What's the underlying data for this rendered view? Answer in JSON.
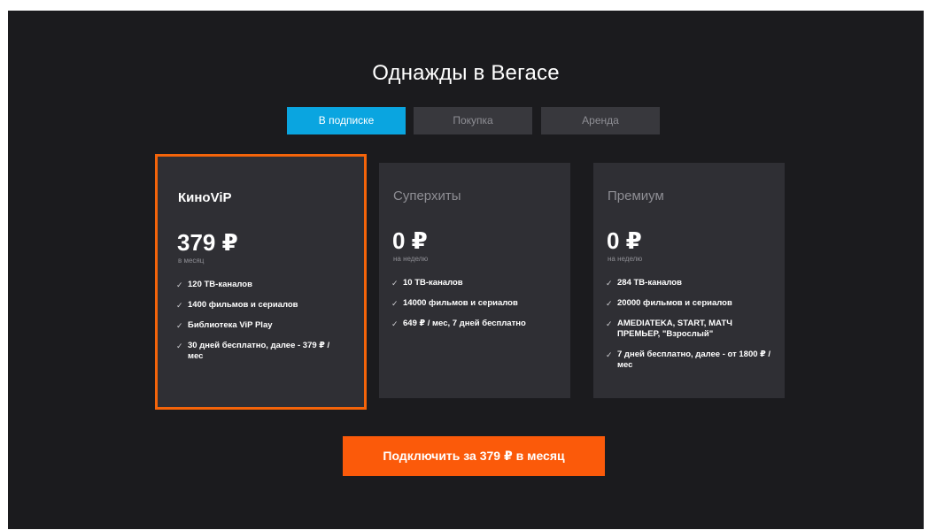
{
  "title": "Однажды в Вегасе",
  "tabs": [
    {
      "label": "В подписке",
      "active": true
    },
    {
      "label": "Покупка",
      "active": false
    },
    {
      "label": "Аренда",
      "active": false
    }
  ],
  "plans": [
    {
      "name": "КиноViP",
      "price": "379 ₽",
      "period": "в месяц",
      "selected": true,
      "features": [
        "120 ТВ-каналов",
        "1400 фильмов и сериалов",
        "Библиотека ViP Play",
        "30 дней бесплатно, далее - 379 ₽ / мес"
      ]
    },
    {
      "name": "Суперхиты",
      "price": "0 ₽",
      "period": "на неделю",
      "selected": false,
      "features": [
        "10 ТВ-каналов",
        "14000 фильмов и сериалов",
        "649 ₽ / мес, 7 дней бесплатно"
      ]
    },
    {
      "name": "Премиум",
      "price": "0 ₽",
      "period": "на неделю",
      "selected": false,
      "features": [
        "284 ТВ-каналов",
        "20000 фильмов и сериалов",
        "AMEDIATEKA, START, МАТЧ ПРЕМЬЕР, \"Взрослый\"",
        "7 дней бесплатно, далее - от 1800 ₽ / мес"
      ]
    }
  ],
  "check_glyph": "✓",
  "cta": {
    "label": "Подключить за 379 ₽ в месяц"
  },
  "colors": {
    "background": "#1b1b1e",
    "card": "#2f2f34",
    "accent_orange": "#fb5a0a",
    "accent_blue": "#0aa5e0",
    "tab_inactive": "#38383d"
  }
}
